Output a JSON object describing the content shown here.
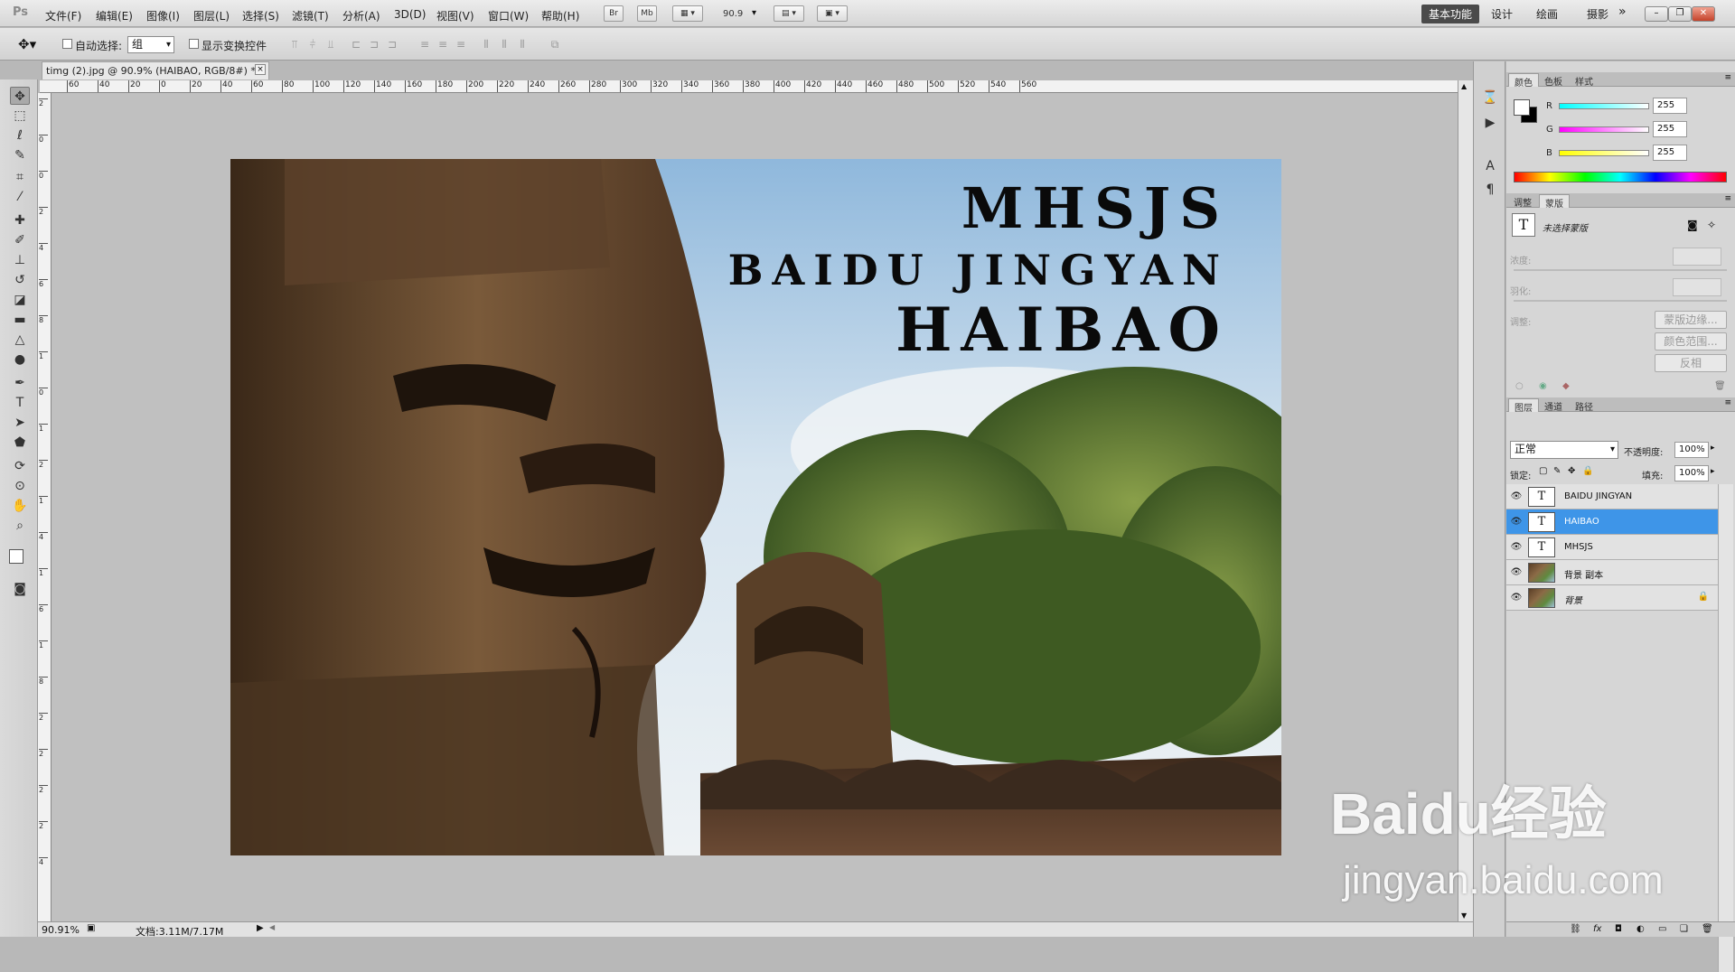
{
  "app": {
    "logo": "Ps",
    "menu": [
      "文件(F)",
      "编辑(E)",
      "图像(I)",
      "图层(L)",
      "选择(S)",
      "滤镜(T)",
      "分析(A)",
      "3D(D)",
      "视图(V)",
      "窗口(W)",
      "帮助(H)"
    ],
    "toolbar_buttons": [
      "Br",
      "Mb"
    ],
    "zoom_select": "90.9",
    "workspaces": [
      "基本功能",
      "设计",
      "绘画",
      "摄影"
    ],
    "workspace_more": "»",
    "window_controls": [
      "–",
      "❐",
      "✕"
    ]
  },
  "options_bar": {
    "auto_select_label": "自动选择:",
    "auto_select_value": "组",
    "show_transform_label": "显示变换控件"
  },
  "document": {
    "tab_title": "timg (2).jpg @ 90.9% (HAIBAO, RGB/8#) *",
    "close": "×",
    "ruler_h": [
      "60",
      "40",
      "20",
      "0",
      "20",
      "40",
      "60",
      "80",
      "100",
      "120",
      "140",
      "160",
      "180",
      "200",
      "220",
      "240",
      "260",
      "280",
      "300",
      "320",
      "340",
      "360",
      "380",
      "400",
      "420",
      "440",
      "460",
      "480",
      "500",
      "520",
      "540",
      "560"
    ],
    "ruler_v": [
      "2",
      "0",
      "0",
      "2",
      "4",
      "6",
      "8",
      "1",
      "0",
      "1",
      "2",
      "1",
      "4",
      "1",
      "6",
      "1",
      "8",
      "2",
      "2",
      "2",
      "2",
      "4"
    ],
    "zoom_status": "90.91%",
    "doc_info": "文档:3.11M/7.17M"
  },
  "poster": {
    "line1": "MHSJS",
    "line2": "BAIDU JINGYAN",
    "line3": "HAIBAO"
  },
  "color_panel": {
    "tabs": [
      "颜色",
      "色板",
      "样式"
    ],
    "r_label": "R",
    "g_label": "G",
    "b_label": "B",
    "r": "255",
    "g": "255",
    "b": "255"
  },
  "adjust_panel": {
    "tabs": [
      "调整",
      "蒙版"
    ],
    "mask_status": "未选择蒙版",
    "density_label": "浓度:",
    "feather_label": "羽化:",
    "refine_label": "调整:",
    "btn_edge": "蒙版边缘...",
    "btn_color_range": "颜色范围...",
    "btn_invert": "反相"
  },
  "layers_panel": {
    "tabs": [
      "图层",
      "通道",
      "路径"
    ],
    "blend_mode": "正常",
    "opacity_label": "不透明度:",
    "opacity": "100%",
    "lock_label": "锁定:",
    "fill_label": "填充:",
    "fill": "100%",
    "layers": [
      {
        "name": "BAIDU JINGYAN",
        "type": "T"
      },
      {
        "name": "HAIBAO",
        "type": "T"
      },
      {
        "name": "MHSJS",
        "type": "T"
      },
      {
        "name": "背景 副本",
        "type": ""
      },
      {
        "name": "背景",
        "type": ""
      }
    ],
    "footer_icons": [
      "link-icon",
      "fx-icon",
      "mask-icon",
      "adjustment-icon",
      "group-icon",
      "new-layer-icon",
      "trash-icon"
    ]
  },
  "watermark": {
    "brand": "Baidu经验",
    "url": "jingyan.baidu.com"
  },
  "colors": {
    "selected_layer": "#3e95e8",
    "ui_gray": "#d6d6d6",
    "canvas_bg": "#c0c0c0"
  }
}
